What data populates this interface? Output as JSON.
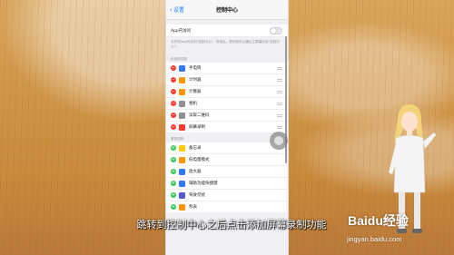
{
  "nav": {
    "back_label": "设置",
    "title": "控制中心"
  },
  "access": {
    "label": "App内访问",
    "note": "允许在App内访问\"控制中心\"。停用后，您仍然可以通过主屏幕访问\"控制中心\"。"
  },
  "included": {
    "header": "包含的控制",
    "items": [
      {
        "label": "手电筒",
        "icon_color": "#3478f6",
        "icon": "flashlight-icon"
      },
      {
        "label": "计时器",
        "icon_color": "#ff9500",
        "icon": "timer-icon"
      },
      {
        "label": "计算器",
        "icon_color": "#ff9500",
        "icon": "calculator-icon"
      },
      {
        "label": "相机",
        "icon_color": "#8e8e93",
        "icon": "camera-icon"
      },
      {
        "label": "读取二维码",
        "icon_color": "#8e8e93",
        "icon": "qr-code-icon"
      },
      {
        "label": "屏幕录制",
        "icon_color": "#ff3b30",
        "icon": "screen-record-icon"
      }
    ]
  },
  "more": {
    "header": "更多控制",
    "items": [
      {
        "label": "备忘录",
        "icon_color": "#ffcc00",
        "icon": "notes-icon"
      },
      {
        "label": "低电量模式",
        "icon_color": "#ff9500",
        "icon": "battery-icon"
      },
      {
        "label": "放大器",
        "icon_color": "#3478f6",
        "icon": "magnifier-icon"
      },
      {
        "label": "辅助功能快捷键",
        "icon_color": "#3478f6",
        "icon": "accessibility-icon"
      },
      {
        "label": "驾驶勿扰",
        "icon_color": "#5856d6",
        "icon": "car-icon"
      },
      {
        "label": "秒表",
        "icon_color": "#ff9500",
        "icon": "stopwatch-icon"
      }
    ]
  },
  "caption": "跳转到控制中心之后点击添加屏幕录制功能",
  "brand": {
    "name": "Baidu经验",
    "url": "jingyan.baidu.com"
  }
}
